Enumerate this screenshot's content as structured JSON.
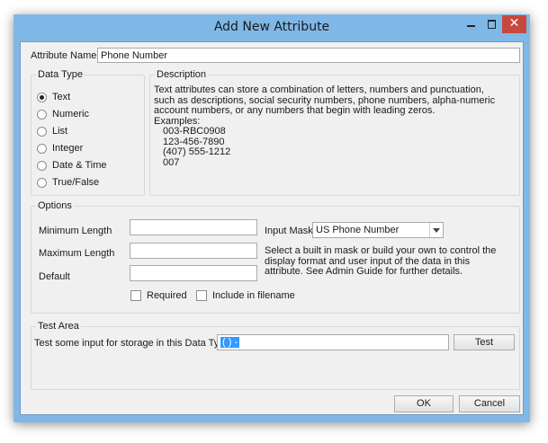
{
  "window": {
    "title": "Add New Attribute",
    "close_glyph": "✕"
  },
  "attribute_name": {
    "label": "Attribute Name:",
    "value": "Phone Number"
  },
  "data_type": {
    "legend": "Data Type",
    "options": [
      "Text",
      "Numeric",
      "List",
      "Integer",
      "Date & Time",
      "True/False"
    ],
    "selected": "Text"
  },
  "description": {
    "legend": "Description",
    "text": "Text attributes can store a combination of letters, numbers and punctuation, such as descriptions, social security numbers, phone numbers, alpha-numeric account numbers, or any numbers that begin with leading zeros.",
    "examples_label": "Examples:",
    "examples": [
      "003-RBC0908",
      "123-456-7890",
      "(407) 555-1212",
      "007"
    ]
  },
  "options": {
    "legend": "Options",
    "min_length_label": "Minimum Length",
    "max_length_label": "Maximum Length",
    "default_label": "Default",
    "input_mask_label": "Input Mask",
    "input_mask_value": "US Phone Number",
    "mask_help": "Select a built in mask or build your own to control the display format and user input of the data in this attribute.  See Admin Guide for further details.",
    "required_label": "Required",
    "include_filename_label": "Include in filename"
  },
  "test_area": {
    "legend": "Test Area",
    "prompt": "Test some input for storage in this Data Type:",
    "input_value": "(   )    -",
    "test_button": "Test"
  },
  "footer": {
    "ok": "OK",
    "cancel": "Cancel"
  }
}
